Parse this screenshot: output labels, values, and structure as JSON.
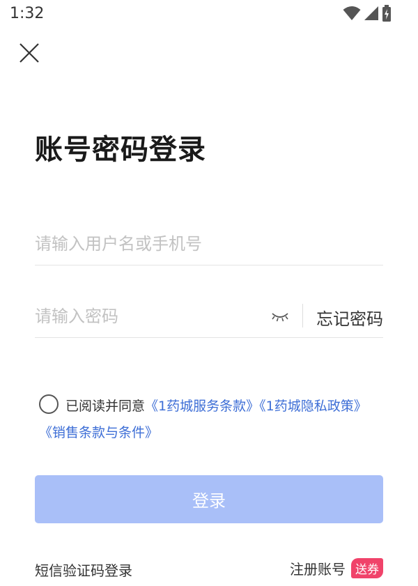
{
  "status_bar": {
    "time": "1:32"
  },
  "page": {
    "title": "账号密码登录"
  },
  "username_field": {
    "placeholder": "请输入用户名或手机号",
    "value": ""
  },
  "password_field": {
    "placeholder": "请输入密码",
    "value": ""
  },
  "forgot_password": "忘记密码",
  "agreement": {
    "checked": false,
    "prefix": "已阅读并同意",
    "links": [
      "《1药城服务条款》",
      "《1药城隐私政策》",
      "《销售条款与条件》"
    ]
  },
  "login_button": {
    "label": "登录",
    "color": "#a9bff8"
  },
  "footer": {
    "sms_login": "短信验证码登录",
    "register": "注册账号",
    "coupon_badge": "送券"
  },
  "colors": {
    "link": "#3d6ed6",
    "badge": "#f0436a"
  }
}
